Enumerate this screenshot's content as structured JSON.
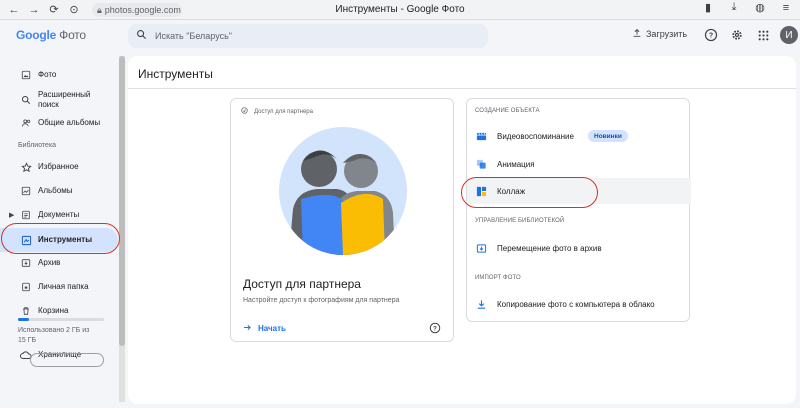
{
  "browser": {
    "url": "photos.google.com",
    "window_title": "Инструменты - Google Фото"
  },
  "header": {
    "logo": "Google",
    "logo_suffix": "Фото",
    "search_placeholder": "Искать \"Беларусь\"",
    "upload_label": "Загрузить",
    "avatar_letter": "И"
  },
  "sidebar": {
    "photos": "Фото",
    "advanced_search": "Расширенный поиск",
    "shared_albums": "Общие альбомы",
    "library_label": "Библиотека",
    "favorites": "Избранное",
    "albums": "Альбомы",
    "documents": "Документы",
    "tools": "Инструменты",
    "archive": "Архив",
    "locked_folder": "Личная папка",
    "trash": "Корзина",
    "storage": "Хранилище",
    "storage_usage": "Использовано 2 ГБ из 15 ГБ",
    "storage_fraction": 0.13
  },
  "main": {
    "title": "Инструменты",
    "partner": {
      "tag": "Доступ для партнера",
      "title": "Доступ для партнера",
      "description": "Настройте доступ к фотографиям для партнера",
      "start": "Начать"
    },
    "tools": {
      "create_section": "СОЗДАНИЕ ОБЪЕКТА",
      "video_memories": "Видеовоспоминание",
      "new_badge": "Новинки",
      "animation": "Анимация",
      "collage": "Коллаж",
      "manage_section": "УПРАВЛЕНИЕ БИБЛИОТЕКОЙ",
      "move_to_archive": "Перемещение фото в архив",
      "import_section": "ИМПОРТ ФОТО",
      "copy_to_cloud": "Копирование фото с компьютера в облако"
    }
  },
  "colors": {
    "accent": "#1a73e8",
    "active_bg": "#d3e3fd",
    "highlight_oval": "#d93025"
  }
}
